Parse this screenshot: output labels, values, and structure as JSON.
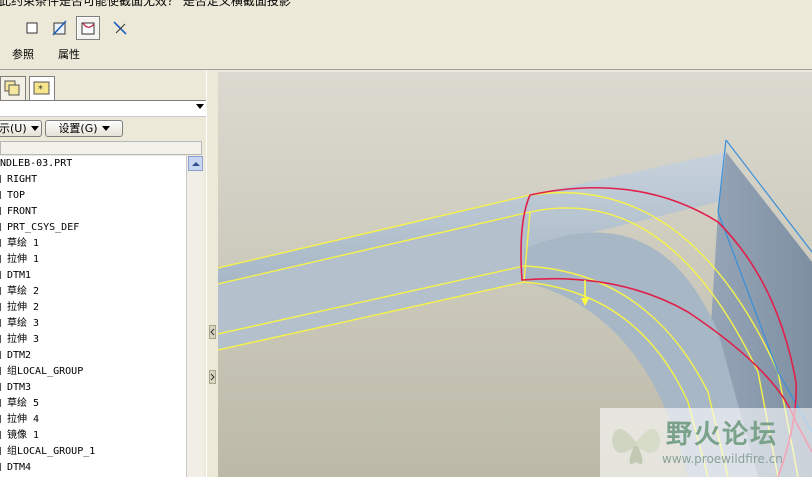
{
  "header": {
    "hint_text": "此约束条件是否可能使截面无效？ 是否定义横截面投影"
  },
  "toolbar": {
    "buttons": [
      {
        "name": "square-icon",
        "active": false
      },
      {
        "name": "slash-square-icon",
        "active": false
      },
      {
        "name": "curve-corner-icon",
        "active": true
      },
      {
        "name": "diagonal-arrows-icon",
        "active": false
      }
    ],
    "tabs": [
      "参照",
      "属性"
    ]
  },
  "panel": {
    "show_button": "示(U)",
    "settings_button": "设置(G)"
  },
  "tree": {
    "items": [
      {
        "label": "NDLEB-03.PRT",
        "icon": false
      },
      {
        "label": "RIGHT",
        "icon": true
      },
      {
        "label": "TOP",
        "icon": true
      },
      {
        "label": "FRONT",
        "icon": true
      },
      {
        "label": "PRT_CSYS_DEF",
        "icon": true
      },
      {
        "label": "草绘 1",
        "icon": true
      },
      {
        "label": "拉伸 1",
        "icon": true
      },
      {
        "label": "DTM1",
        "icon": true
      },
      {
        "label": "草绘 2",
        "icon": true
      },
      {
        "label": "拉伸 2",
        "icon": true
      },
      {
        "label": "草绘 3",
        "icon": true
      },
      {
        "label": "拉伸 3",
        "icon": true
      },
      {
        "label": "DTM2",
        "icon": true
      },
      {
        "label": "组LOCAL_GROUP",
        "icon": true
      },
      {
        "label": "DTM3",
        "icon": true
      },
      {
        "label": "草绘 5",
        "icon": true
      },
      {
        "label": "拉伸 4",
        "icon": true
      },
      {
        "label": "镜像 1",
        "icon": true
      },
      {
        "label": "组LOCAL_GROUP_1",
        "icon": true
      },
      {
        "label": "DTM4",
        "icon": true
      }
    ]
  },
  "watermark": {
    "title": "野火论坛",
    "url": "www.proewildfire.cn"
  },
  "colors": {
    "model_body": "#a9b8c6",
    "edge_yellow": "#ffff40",
    "curve_red": "#e0204a",
    "edge_blue": "#3a8fd8",
    "viewport_bg": "#cfcdc0"
  }
}
